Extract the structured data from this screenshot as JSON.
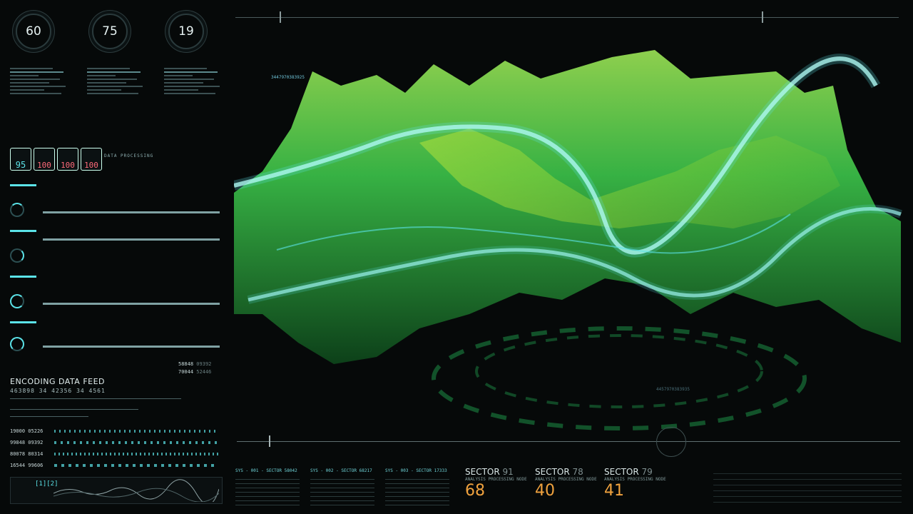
{
  "gauges": [
    {
      "value": "60"
    },
    {
      "value": "75"
    },
    {
      "value": "19"
    }
  ],
  "data_processing": {
    "label": "DATA PROCESSING",
    "chips": [
      "95",
      "100",
      "100",
      "100"
    ],
    "chip_colors": [
      "#5be3e8",
      "#ff6b7a",
      "#ff6b7a",
      "#ff6b7a"
    ]
  },
  "feed": {
    "title": "ENCODING DATA FEED",
    "numbers": "463898  34 42356  34  4561",
    "side_values": [
      "58848",
      "09392",
      "70044",
      "52446"
    ],
    "rows": [
      {
        "a": "19000",
        "b": "05226"
      },
      {
        "a": "99848",
        "b": "09392"
      },
      {
        "a": "80078",
        "b": "80314"
      },
      {
        "a": "16544",
        "b": "99606"
      }
    ]
  },
  "terrain": {
    "readout_top": "3447970383925",
    "readout_bottom": "4457970383935"
  },
  "sectors": [
    {
      "name": "SECTOR",
      "id": "91",
      "sub": "ANALYSIS PROCESSING NODE",
      "value": "68"
    },
    {
      "name": "SECTOR",
      "id": "78",
      "sub": "ANALYSIS PROCESSING NODE",
      "value": "40"
    },
    {
      "name": "SECTOR",
      "id": "79",
      "sub": "ANALYSIS PROCESSING NODE",
      "value": "41"
    }
  ],
  "sys": [
    {
      "label": "SYS - 001 - SECTOR 58042"
    },
    {
      "label": "SYS - 002 - SECTOR 68217"
    },
    {
      "label": "SYS - 003 - SECTOR 17333"
    }
  ],
  "bottom_left_label": "[1][2]",
  "colors": {
    "accent": "#5be3e8",
    "orange": "#f0a23e",
    "green": "#2bdc6a"
  }
}
